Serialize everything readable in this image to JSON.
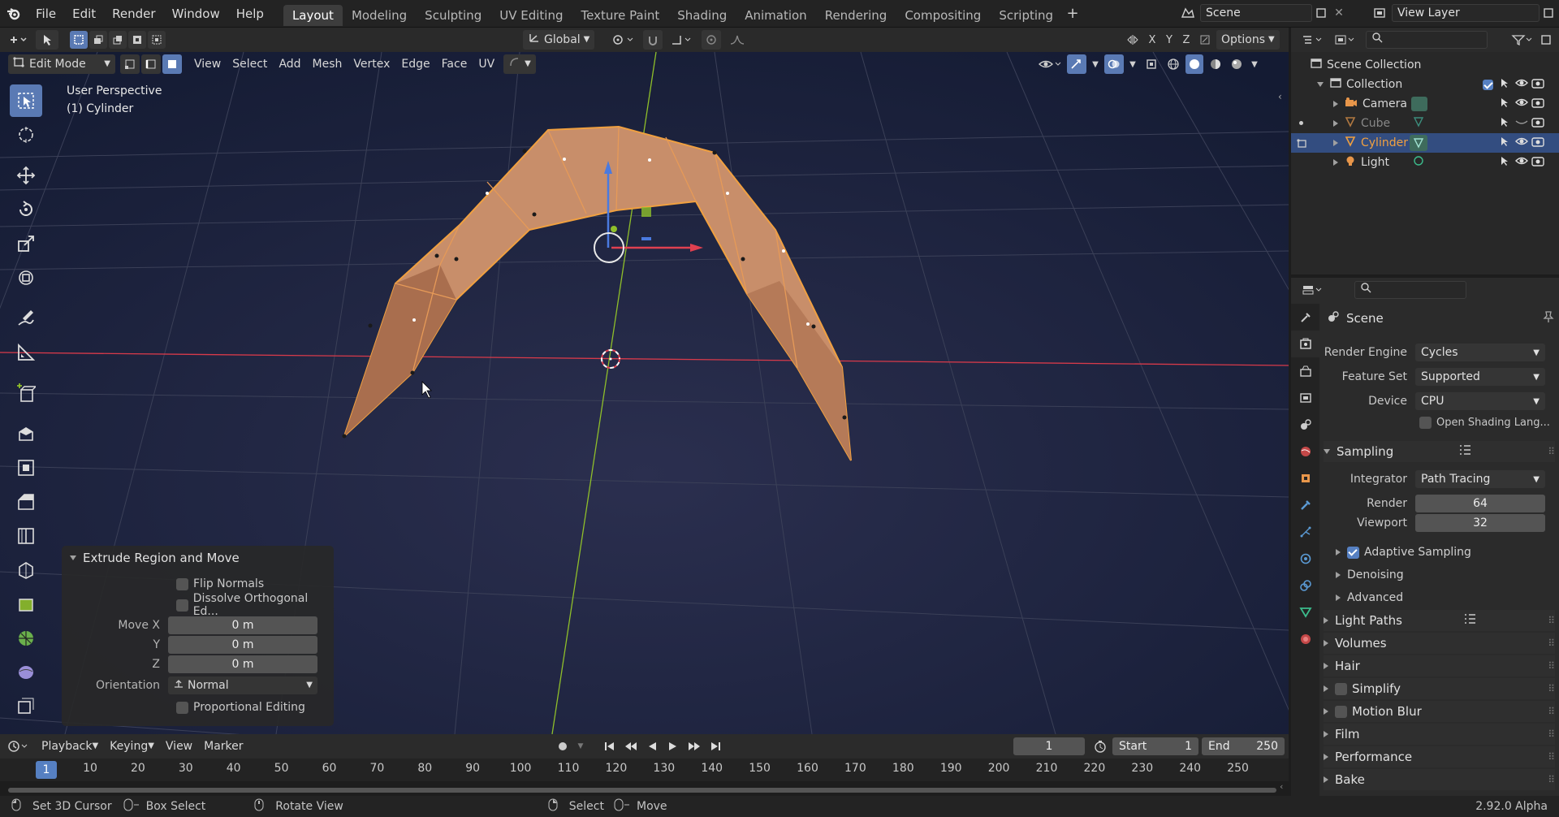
{
  "menu": [
    "File",
    "Edit",
    "Render",
    "Window",
    "Help"
  ],
  "workspaces": [
    "Layout",
    "Modeling",
    "Sculpting",
    "UV Editing",
    "Texture Paint",
    "Shading",
    "Animation",
    "Rendering",
    "Compositing",
    "Scripting"
  ],
  "active_workspace": "Layout",
  "scene_name": "Scene",
  "view_layer": "View Layer",
  "header2": {
    "transform": "Global",
    "options": "Options",
    "axes": [
      "X",
      "Y",
      "Z"
    ]
  },
  "viewport_header": {
    "mode": "Edit Mode",
    "menus": [
      "View",
      "Select",
      "Add",
      "Mesh",
      "Vertex",
      "Edge",
      "Face",
      "UV"
    ]
  },
  "viewport": {
    "perspective": "User Perspective",
    "object": "(1) Cylinder"
  },
  "redo_panel": {
    "title": "Extrude Region and Move",
    "flip_normals": "Flip Normals",
    "dissolve": "Dissolve Orthogonal Ed...",
    "move_x_label": "Move X",
    "y_label": "Y",
    "z_label": "Z",
    "move_x": "0 m",
    "move_y": "0 m",
    "move_z": "0 m",
    "orientation_label": "Orientation",
    "orientation": "Normal",
    "proportional": "Proportional Editing"
  },
  "timeline": {
    "menus": [
      "Playback",
      "Keying",
      "View",
      "Marker"
    ],
    "current_frame": "1",
    "start_label": "Start",
    "start": "1",
    "end_label": "End",
    "end": "250",
    "ruler_current": "1",
    "ruler": [
      "10",
      "20",
      "30",
      "40",
      "50",
      "60",
      "70",
      "80",
      "90",
      "100",
      "110",
      "120",
      "130",
      "140",
      "150",
      "160",
      "170",
      "180",
      "190",
      "200",
      "210",
      "220",
      "230",
      "240",
      "250"
    ]
  },
  "status": {
    "set_cursor": "Set 3D Cursor",
    "box_select": "Box Select",
    "rotate": "Rotate View",
    "select": "Select",
    "move": "Move",
    "version": "2.92.0 Alpha"
  },
  "outliner": {
    "root": "Scene Collection",
    "collection": "Collection",
    "items": [
      "Camera",
      "Cube",
      "Cylinder",
      "Light"
    ]
  },
  "properties": {
    "context": "Scene",
    "render_engine_label": "Render Engine",
    "render_engine": "Cycles",
    "feature_set_label": "Feature Set",
    "feature_set": "Supported",
    "device_label": "Device",
    "device": "CPU",
    "osl": "Open Shading Lang...",
    "sampling": "Sampling",
    "integrator_label": "Integrator",
    "integrator": "Path Tracing",
    "render_label": "Render",
    "render_samples": "64",
    "viewport_label": "Viewport",
    "viewport_samples": "32",
    "adaptive": "Adaptive Sampling",
    "denoising": "Denoising",
    "advanced": "Advanced",
    "light_paths": "Light Paths",
    "volumes": "Volumes",
    "hair": "Hair",
    "simplify": "Simplify",
    "motion_blur": "Motion Blur",
    "film": "Film",
    "performance": "Performance",
    "bake": "Bake"
  },
  "colors": {
    "accent": "#5a7ab4",
    "mesh_face": "#c88e6a",
    "active_outline": "#f0a040",
    "x_axis": "#d83a4a",
    "y_axis": "#8fbf2a",
    "viewport_bg_top": "#141b33",
    "viewport_bg_bottom": "#2b2f4f"
  }
}
